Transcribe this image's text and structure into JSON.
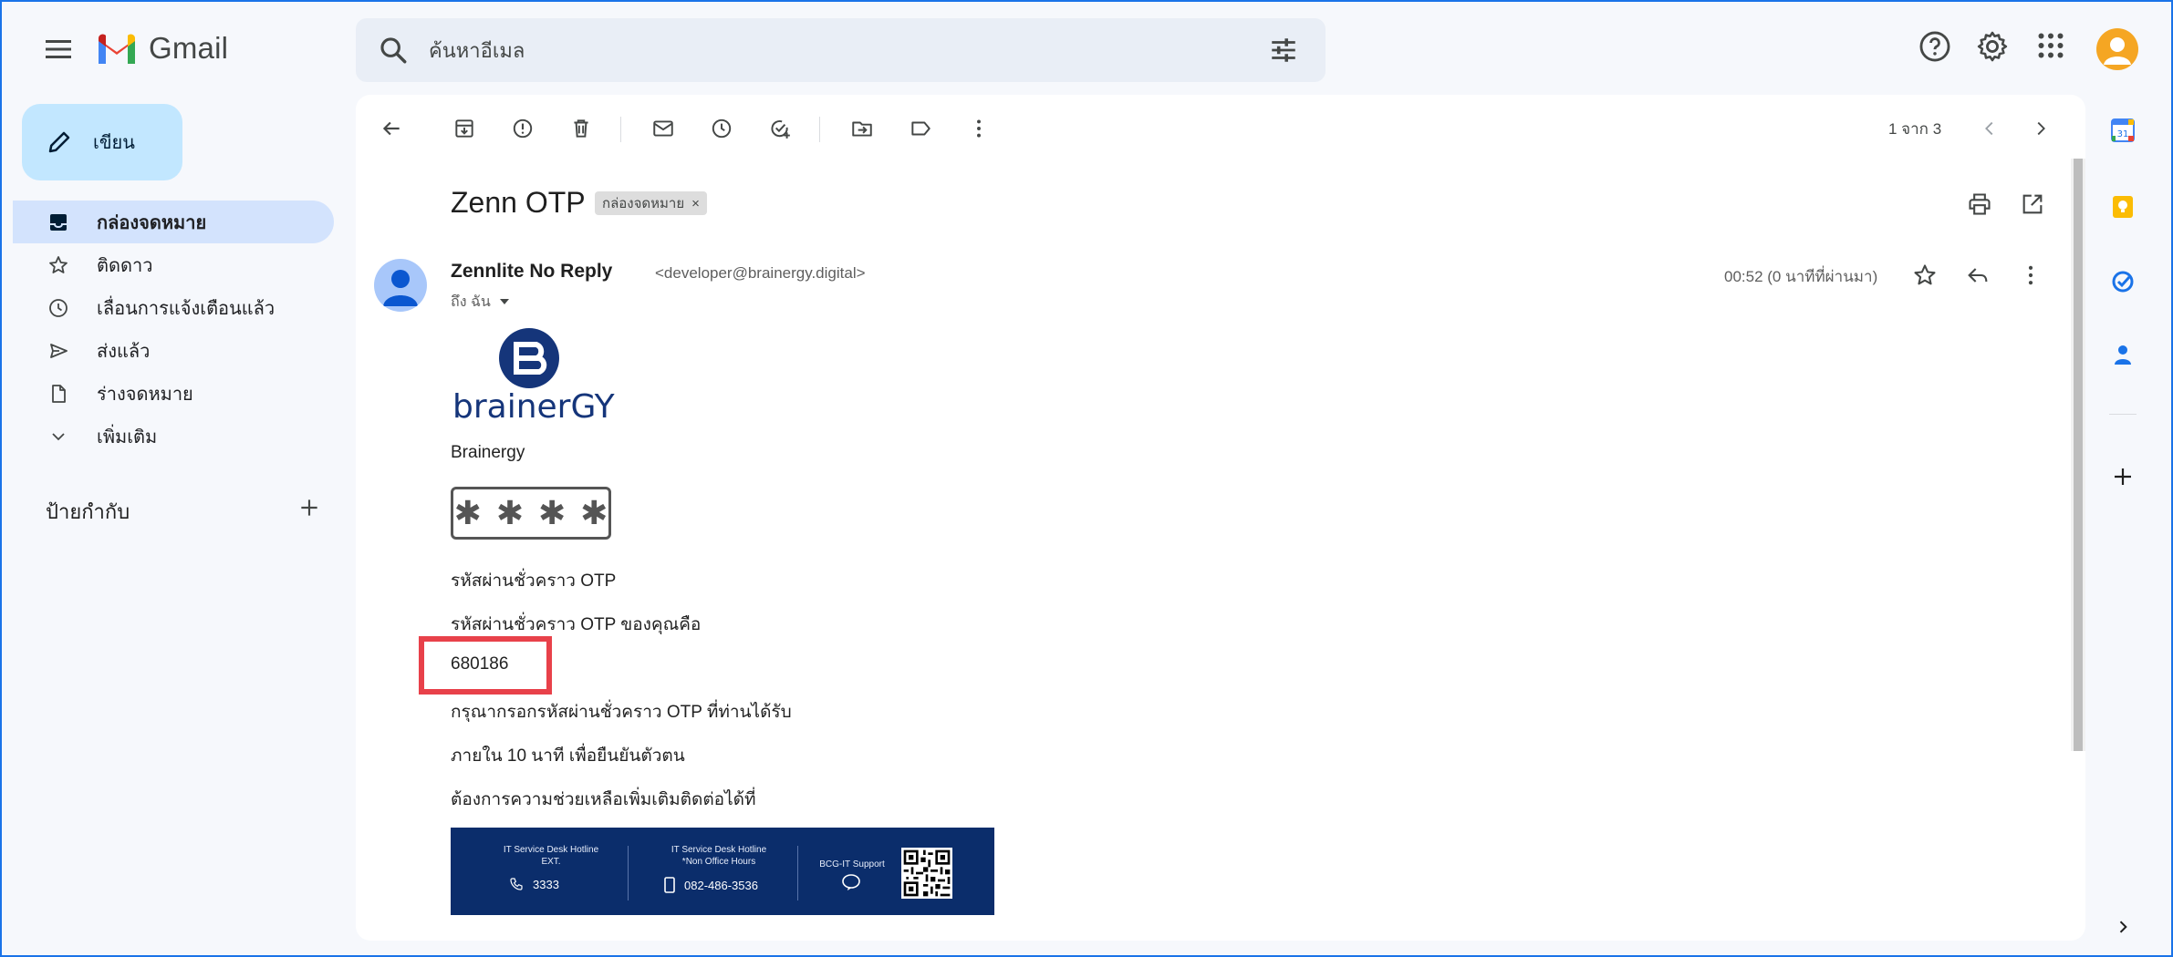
{
  "app": {
    "name": "Gmail"
  },
  "search": {
    "placeholder": "ค้นหาอีเมล"
  },
  "compose": {
    "label": "เขียน"
  },
  "nav": {
    "items": [
      {
        "label": "กล่องจดหมาย",
        "icon": "inbox-icon",
        "active": true
      },
      {
        "label": "ติดดาว",
        "icon": "star-icon"
      },
      {
        "label": "เลื่อนการแจ้งเตือนแล้ว",
        "icon": "clock-icon"
      },
      {
        "label": "ส่งแล้ว",
        "icon": "send-icon"
      },
      {
        "label": "ร่างจดหมาย",
        "icon": "draft-icon"
      },
      {
        "label": "เพิ่มเติม",
        "icon": "chevron-down-icon"
      }
    ],
    "labels_heading": "ป้ายกำกับ"
  },
  "toolbar": {
    "pager": "1 จาก 3"
  },
  "email": {
    "subject": "Zenn OTP",
    "label_chip": "กล่องจดหมาย",
    "label_chip_close": "×",
    "sender_name": "Zennlite No Reply",
    "sender_email": "<developer@brainergy.digital>",
    "to": "ถึง ฉัน",
    "time": "00:52 (0 นาทีที่ผ่านมา)"
  },
  "body": {
    "brand_logo_text": "brainerGY",
    "brand_name": "Brainergy",
    "password_mask": [
      "✱",
      "✱",
      "✱",
      "✱"
    ],
    "line1": "รหัสผ่านชั่วคราว OTP",
    "line2": "รหัสผ่านชั่วคราว OTP ของคุณคือ",
    "otp": "680186",
    "line3": "กรุณากรอกรหัสผ่านชั่วคราว OTP ที่ท่านได้รับ",
    "line4": "ภายใน 10 นาที เพื่อยืนยันตัวตน",
    "line5": "ต้องการความช่วยเหลือเพิ่มเติมติดต่อได้ที่"
  },
  "banner": {
    "col1_title": "IT Service Desk Hotline",
    "col1_sub": "EXT.",
    "col1_number": "3333",
    "col2_title": "IT Service Desk Hotline",
    "col2_sub": "*Non Office Hours",
    "col2_number": "082-486-3536",
    "col3_title": "BCG-IT Support"
  },
  "colors": {
    "accent": "#1a73e8",
    "compose_bg": "#c2e7ff",
    "nav_active": "#d3e3fd",
    "highlight": "#e8414a",
    "banner_bg": "#0b2d6b"
  }
}
